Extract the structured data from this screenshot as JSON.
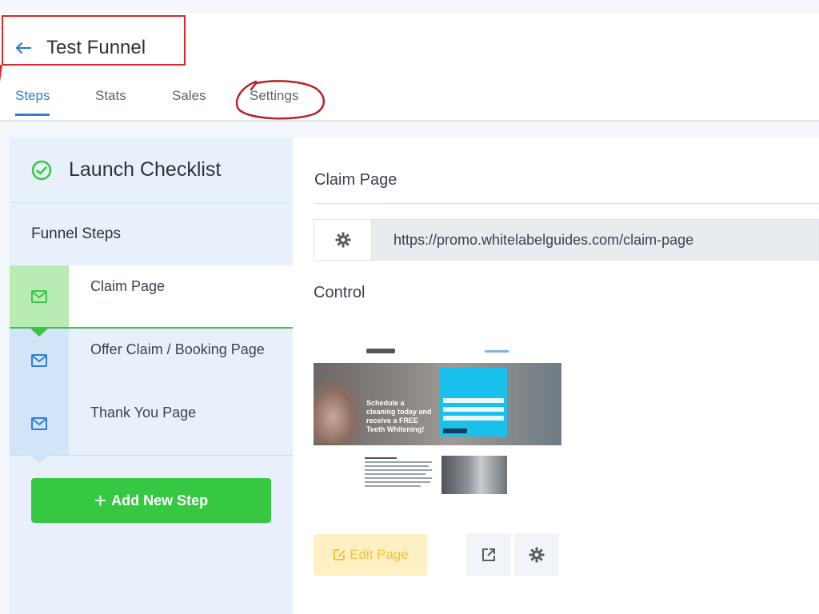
{
  "header": {
    "title": "Test Funnel",
    "tabs": [
      {
        "label": "Steps",
        "active": true
      },
      {
        "label": "Stats",
        "active": false
      },
      {
        "label": "Sales",
        "active": false
      },
      {
        "label": "Settings",
        "active": false
      }
    ]
  },
  "left_panel": {
    "checklist_title": "Launch Checklist",
    "funnel_steps_title": "Funnel Steps",
    "steps": [
      {
        "label": "Claim Page",
        "icon": "mail-icon",
        "active": true
      },
      {
        "label": "Offer Claim / Booking Page",
        "icon": "mail-icon",
        "active": false
      },
      {
        "label": "Thank You Page",
        "icon": "mail-icon",
        "active": false
      }
    ],
    "add_step_label": "Add New Step"
  },
  "right_panel": {
    "title": "Claim Page",
    "url": "https://promo.whitelabelguides.com/claim-page",
    "control_label": "Control",
    "thumbnail": {
      "hero_text": "Schedule a cleaning today and receive a FREE Teeth Whitening!"
    },
    "edit_page_label": "Edit Page"
  },
  "colors": {
    "accent_blue": "#2f7fd0",
    "success_green": "#36c743",
    "annotation_red": "#e0252f",
    "edit_yellow": "#f5c33b"
  }
}
